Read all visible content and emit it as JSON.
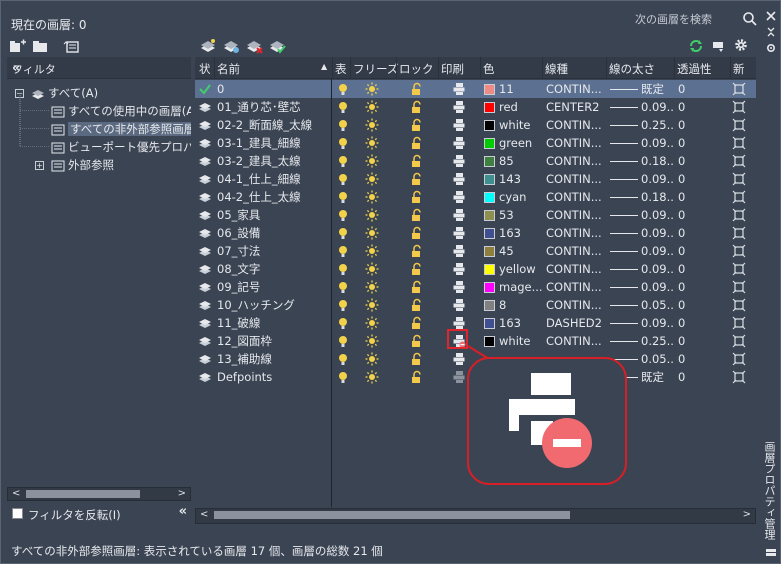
{
  "app": {
    "current_layer_label": "現在の画層: 0",
    "search_placeholder": "次の画層を検索",
    "palette_title": "画層プロパティ管理"
  },
  "filter": {
    "header": "フィルタ",
    "collapse_glyph": "«",
    "tree": [
      {
        "label": "すべて(A)",
        "level": 0,
        "expander": "−"
      },
      {
        "label": "すべての使用中の画層(A)",
        "level": 1
      },
      {
        "label": "すべての非外部参照画層",
        "level": 1,
        "selected": true
      },
      {
        "label": "ビューポート優先プロパティを",
        "level": 1
      },
      {
        "label": "外部参照",
        "level": 1,
        "expander": "+"
      }
    ],
    "invert_label": "フィルタを反転(I)"
  },
  "grid": {
    "headers": [
      "状",
      "名前",
      "表",
      "フリーズ",
      "ロック",
      "印刷",
      "色",
      "線種",
      "線の太さ",
      "透過性",
      "新"
    ],
    "rows": [
      {
        "status": "✔",
        "name": "0",
        "color_name": "11",
        "color": "#f08a84",
        "linetype": "CONTIN...",
        "lineweight": "既定",
        "transparency": "0",
        "selected": true,
        "print": "on"
      },
      {
        "status": "▰",
        "name": "01_通り芯･壁芯",
        "color_name": "red",
        "color": "#ff0000",
        "linetype": "CENTER2",
        "lineweight": "0.09...",
        "transparency": "0",
        "print": "on"
      },
      {
        "status": "▰",
        "name": "02-2_断面線_太線",
        "color_name": "white",
        "color": "#000000",
        "linetype": "CONTIN...",
        "lineweight": "0.25...",
        "transparency": "0",
        "print": "on"
      },
      {
        "status": "▰",
        "name": "03-1_建具_細線",
        "color_name": "green",
        "color": "#00cc00",
        "linetype": "CONTIN...",
        "lineweight": "0.09...",
        "transparency": "0",
        "print": "on"
      },
      {
        "status": "▰",
        "name": "03-2_建具_太線",
        "color_name": "85",
        "color": "#3f7f3f",
        "linetype": "CONTIN...",
        "lineweight": "0.18...",
        "transparency": "0",
        "print": "on"
      },
      {
        "status": "▰",
        "name": "04-1_仕上_細線",
        "color_name": "143",
        "color": "#3f8f8f",
        "linetype": "CONTIN...",
        "lineweight": "0.09...",
        "transparency": "0",
        "print": "on"
      },
      {
        "status": "▰",
        "name": "04-2_仕上_太線",
        "color_name": "cyan",
        "color": "#00ffff",
        "linetype": "CONTIN...",
        "lineweight": "0.18...",
        "transparency": "0",
        "print": "on"
      },
      {
        "status": "▰",
        "name": "05_家具",
        "color_name": "53",
        "color": "#8f8f4f",
        "linetype": "CONTIN...",
        "lineweight": "0.09...",
        "transparency": "0",
        "print": "on"
      },
      {
        "status": "▰",
        "name": "06_設備",
        "color_name": "163",
        "color": "#3f4f8f",
        "linetype": "CONTIN...",
        "lineweight": "0.09...",
        "transparency": "0",
        "print": "on"
      },
      {
        "status": "▰",
        "name": "07_寸法",
        "color_name": "45",
        "color": "#8f7f3f",
        "linetype": "CONTIN...",
        "lineweight": "0.09...",
        "transparency": "0",
        "print": "on"
      },
      {
        "status": "▰",
        "name": "08_文字",
        "color_name": "yellow",
        "color": "#ffff00",
        "linetype": "CONTIN...",
        "lineweight": "0.09...",
        "transparency": "0",
        "print": "on"
      },
      {
        "status": "▰",
        "name": "09_記号",
        "color_name": "mage...",
        "color": "#ff00ff",
        "linetype": "CONTIN...",
        "lineweight": "0.09...",
        "transparency": "0",
        "print": "on"
      },
      {
        "status": "▰",
        "name": "10_ハッチング",
        "color_name": "8",
        "color": "#808080",
        "linetype": "CONTIN...",
        "lineweight": "0.05...",
        "transparency": "0",
        "print": "on"
      },
      {
        "status": "▰",
        "name": "11_破線",
        "color_name": "163",
        "color": "#3f4f8f",
        "linetype": "DASHED2",
        "lineweight": "0.09...",
        "transparency": "0",
        "print": "on"
      },
      {
        "status": "▰",
        "name": "12_図面枠",
        "color_name": "white",
        "color": "#000000",
        "linetype": "CONTIN...",
        "lineweight": "0.25...",
        "transparency": "0",
        "print": "off"
      },
      {
        "status": "▰",
        "name": "13_補助線",
        "color_name": "",
        "color": "#3b4453",
        "linetype": "",
        "lineweight": "0.05...",
        "transparency": "0",
        "print": "on"
      },
      {
        "status": "▰",
        "name": "Defpoints",
        "color_name": "",
        "color": "#3b4453",
        "linetype": "",
        "lineweight": "既定",
        "transparency": "0",
        "print": "dim"
      }
    ]
  },
  "status_bar": "すべての非外部参照画層: 表示されている画層 17 個、画層の総数 21 個",
  "colors": {
    "background": "#3b4453",
    "selection": "#5c7191",
    "callout": "#e0262c"
  }
}
